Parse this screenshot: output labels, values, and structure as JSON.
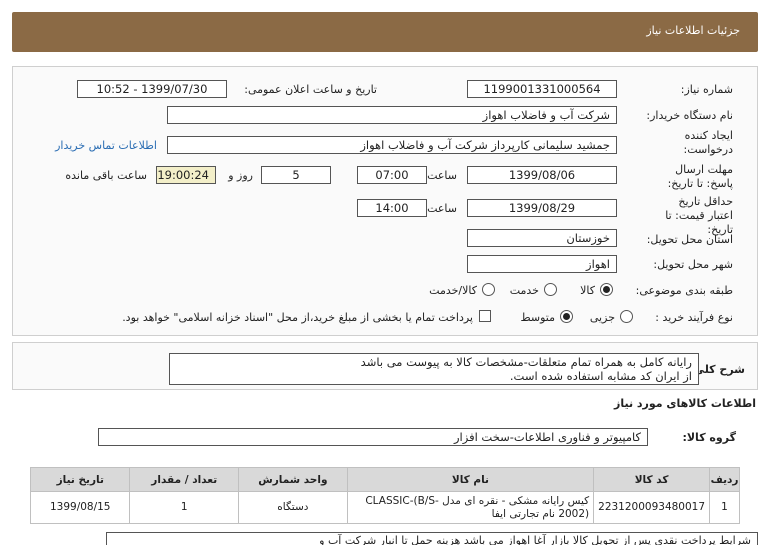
{
  "header": {
    "title": "جزئیات اطلاعات نیاز"
  },
  "form": {
    "need_number_label": "شماره نیاز:",
    "need_number": "1199001331000564",
    "announce_label": "تاریخ و ساعت اعلان عمومی:",
    "announce_value": "1399/07/30 - 10:52",
    "buyer_org_label": "نام دستگاه خریدار:",
    "buyer_org": "شرکت آب و فاضلاب اهواز",
    "creator_label": "ایجاد کننده درخواست:",
    "creator": "جمشید سلیمانی کارپرداز شرکت آب و فاضلاب اهواز",
    "contact_link": "اطلاعات تماس خریدار",
    "send_deadline_label": "مهلت ارسال پاسخ: تا تاریخ:",
    "send_date": "1399/08/06",
    "time_label": "ساعت",
    "send_time": "07:00",
    "days": "5",
    "days_label": "روز و",
    "remaining": "19:00:24",
    "remaining_label": "ساعت باقی مانده",
    "validity_label": "حداقل تاریخ اعتبار قیمت: تا تاریخ:",
    "validity_date": "1399/08/29",
    "validity_time": "14:00",
    "province_label": "استان محل تحویل:",
    "province": "خوزستان",
    "city_label": "شهر محل تحویل:",
    "city": "اهواز",
    "category_label": "طبقه بندی موضوعی:",
    "category_options": [
      "کالا",
      "خدمت",
      "کالا/خدمت"
    ],
    "process_label": "نوع فرآیند خرید :",
    "process_options": [
      "جزیی",
      "متوسط"
    ],
    "payment_note": "پرداخت تمام یا بخشی از مبلغ خرید،از محل \"اسناد خزانه اسلامی\" خواهد بود."
  },
  "description": {
    "label": "شرح کلی نیاز:",
    "line1": "رایانه کامل به همراه تمام متعلقات-مشخصات کالا به پیوست می باشد",
    "line2": "از ایران کد مشابه استفاده شده است."
  },
  "goods_section": {
    "title": "اطلاعات کالاهای مورد نیاز",
    "group_label": "گروه کالا:",
    "group_value": "کامپیوتر و فناوری اطلاعات-سخت افزار"
  },
  "table": {
    "headers": [
      "ردیف",
      "کد کالا",
      "نام کالا",
      "واحد شمارش",
      "تعداد / مقدار",
      "تاریخ نیاز"
    ],
    "rows": [
      [
        "1",
        "2231200093480017",
        "کیس رایانه مشکی - نقره ای مدل CLASSIC-(B/S-2002) نام تجارتی ایفا",
        "دستگاه",
        "1",
        "1399/08/15"
      ]
    ]
  },
  "bottom_note": "شرایط پرداخت نقدی پس از تحویل کالا بازار آغا اهواز می باشد هزینه حمل تا انبار شرکت آب و"
}
